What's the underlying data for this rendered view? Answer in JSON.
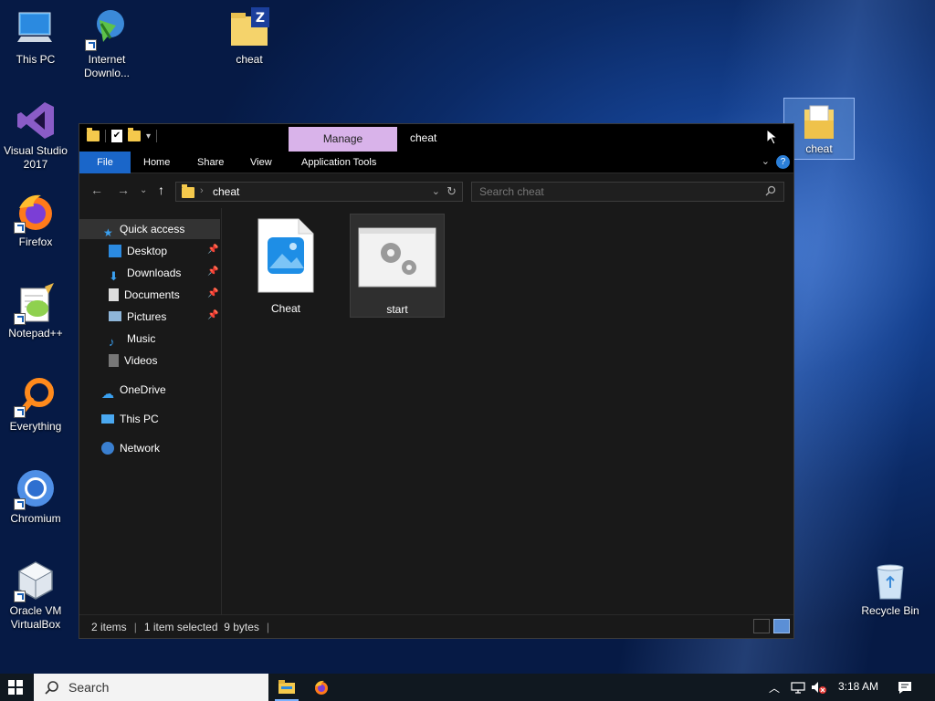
{
  "desktop": {
    "icons": [
      {
        "label": "This PC"
      },
      {
        "label": "Internet Downlo..."
      },
      {
        "label": "cheat"
      },
      {
        "label": "Visual Studio 2017"
      },
      {
        "label": "Firefox"
      },
      {
        "label": "Notepad++"
      },
      {
        "label": "Everything"
      },
      {
        "label": "Chromium"
      },
      {
        "label": "Oracle VM VirtualBox"
      },
      {
        "label": "cheat"
      },
      {
        "label": "Recycle Bin"
      }
    ]
  },
  "explorer": {
    "title": "cheat",
    "contextual_tab": "Manage",
    "ribbon_tabs": [
      "File",
      "Home",
      "Share",
      "View",
      "Application Tools"
    ],
    "address": {
      "path": "cheat"
    },
    "search": {
      "placeholder": "Search cheat"
    },
    "nav": {
      "quick_access": "Quick access",
      "items": [
        "Desktop",
        "Downloads",
        "Documents",
        "Pictures",
        "Music",
        "Videos"
      ],
      "onedrive": "OneDrive",
      "thispc": "This PC",
      "network": "Network"
    },
    "files": [
      {
        "name": "Cheat",
        "type": "image"
      },
      {
        "name": "start",
        "type": "application",
        "selected": true
      }
    ],
    "status": {
      "items": "2 items",
      "selected": "1 item selected",
      "size": "9 bytes"
    }
  },
  "taskbar": {
    "search_label": "Search",
    "time": "3:18 AM"
  },
  "colors": {
    "accent": "#1a66c9",
    "manage_tab": "#d9b3ea",
    "folder": "#f5c94c"
  }
}
